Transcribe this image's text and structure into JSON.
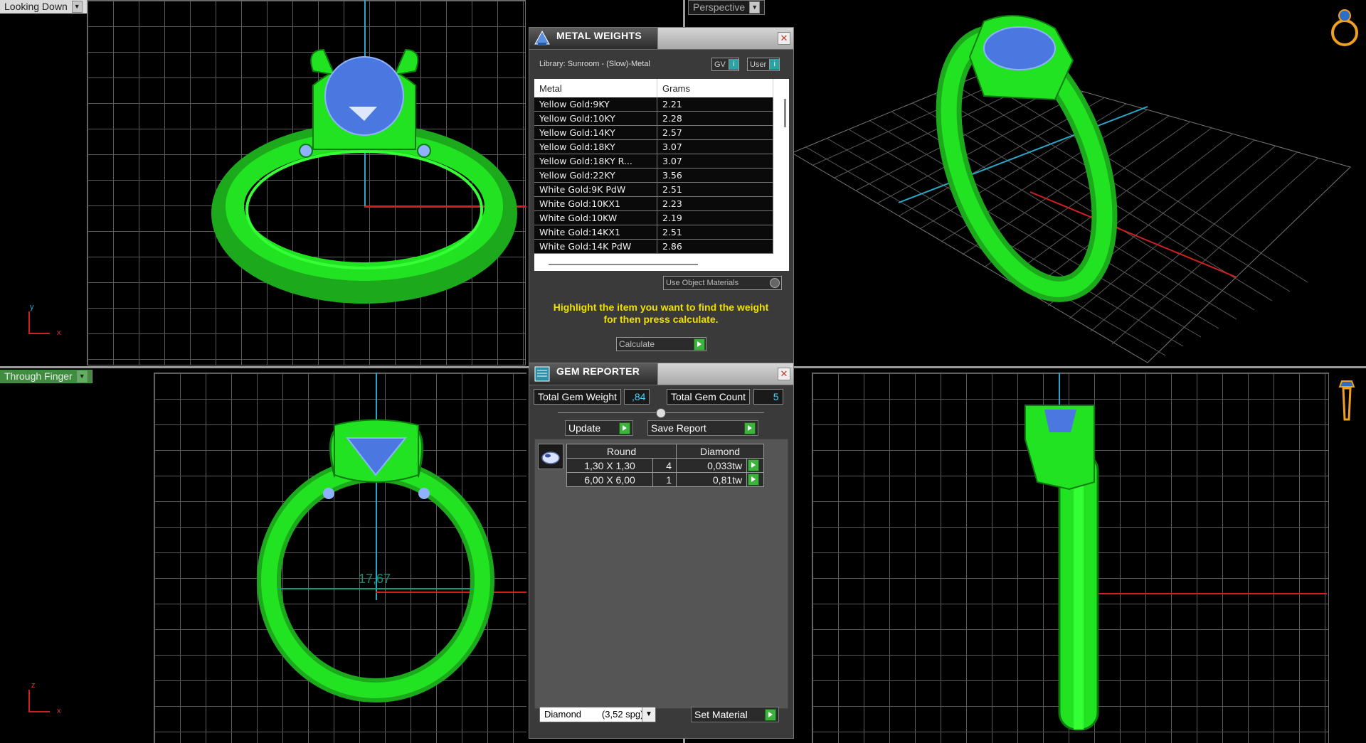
{
  "viewports": {
    "top_left": {
      "label": "Looking Down"
    },
    "top_right": {
      "label": "Perspective"
    },
    "bottom_left": {
      "label": "Through Finger",
      "measurement": "17,67"
    },
    "bottom_right": {
      "label": ""
    }
  },
  "axis": {
    "up_top_left": "y",
    "up_bottom_left": "z",
    "right": "x"
  },
  "metal_weights": {
    "title": "METAL WEIGHTS",
    "library": "Library: Sunroom - (Slow)-Metal",
    "gv_label": "GV",
    "user_label": "User",
    "columns": [
      "Metal",
      "Grams"
    ],
    "rows": [
      [
        "Yellow Gold:9KY",
        "2.21"
      ],
      [
        "Yellow Gold:10KY",
        "2.28"
      ],
      [
        "Yellow Gold:14KY",
        "2.57"
      ],
      [
        "Yellow Gold:18KY",
        "3.07"
      ],
      [
        "Yellow Gold:18KY R...",
        "3.07"
      ],
      [
        "Yellow Gold:22KY",
        "3.56"
      ],
      [
        "White Gold:9K PdW",
        "2.51"
      ],
      [
        "White Gold:10KX1",
        "2.23"
      ],
      [
        "White Gold:10KW",
        "2.19"
      ],
      [
        "White Gold:14KX1",
        "2.51"
      ],
      [
        "White Gold:14K PdW",
        "2.86"
      ]
    ],
    "use_object_materials": "Use Object Materials",
    "hint_line1": "Highlight the item you want to find the weight",
    "hint_line2": "for then press calculate.",
    "calculate": "Calculate"
  },
  "gem_reporter": {
    "title": "GEM REPORTER",
    "total_weight_label": "Total Gem Weight",
    "total_weight_value": ",84",
    "total_count_label": "Total Gem Count",
    "total_count_value": "5",
    "update": "Update",
    "save_report": "Save Report",
    "headers": [
      "Round",
      "Diamond"
    ],
    "rows": [
      {
        "size": "1,30 X 1,30",
        "count": "4",
        "weight": "0,033tw"
      },
      {
        "size": "6,00 X 6,00",
        "count": "1",
        "weight": "0,81tw"
      }
    ],
    "material_select": "Diamond        (3,52 spg)",
    "set_material": "Set Material"
  },
  "colors": {
    "ring": "#22e322",
    "gem": "#4a78e0",
    "axis_red": "#d02020",
    "axis_cyan": "#2aa8c8",
    "hint": "#f0e000"
  }
}
